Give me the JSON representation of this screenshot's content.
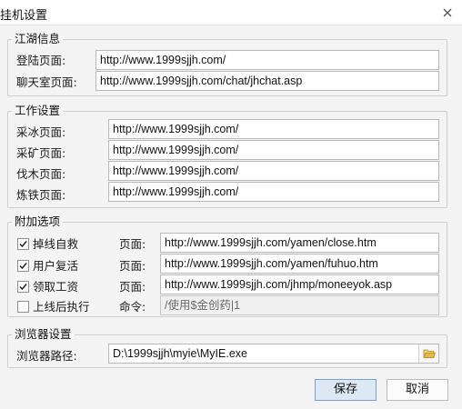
{
  "window": {
    "title": "挂机设置"
  },
  "group1": {
    "title": "江湖信息",
    "rows": [
      {
        "label": "登陆页面:",
        "value": "http://www.1999sjjh.com/"
      },
      {
        "label": "聊天室页面:",
        "value": "http://www.1999sjjh.com/chat/jhchat.asp"
      }
    ]
  },
  "group2": {
    "title": "工作设置",
    "rows": [
      {
        "label": "采冰页面:",
        "value": "http://www.1999sjjh.com/"
      },
      {
        "label": "采矿页面:",
        "value": "http://www.1999sjjh.com/"
      },
      {
        "label": "伐木页面:",
        "value": "http://www.1999sjjh.com/"
      },
      {
        "label": "炼铁页面:",
        "value": "http://www.1999sjjh.com/"
      }
    ]
  },
  "group3": {
    "title": "附加选项",
    "rows": [
      {
        "label": "掉线自救",
        "checked": true,
        "field_label": "页面:",
        "value": "http://www.1999sjjh.com/yamen/close.htm"
      },
      {
        "label": "用户复活",
        "checked": true,
        "field_label": "页面:",
        "value": "http://www.1999sjjh.com/yamen/fuhuo.htm"
      },
      {
        "label": "领取工资",
        "checked": true,
        "field_label": "页面:",
        "value": "http://www.1999sjjh.com/jhmp/moneeyok.asp"
      },
      {
        "label": "上线后执行",
        "checked": false,
        "field_label": "命令:",
        "value": "/使用$金创药|1"
      }
    ]
  },
  "group4": {
    "title": "浏览器设置",
    "label": "浏览器路径:",
    "value": "D:\\1999sjjh\\myie\\MyIE.exe"
  },
  "buttons": {
    "save": "保存",
    "cancel": "取消"
  },
  "colors": {
    "accent_border": "#7aa0d0",
    "accent_fill": "#dde8f5",
    "folder_icon": "#e8b84a"
  }
}
